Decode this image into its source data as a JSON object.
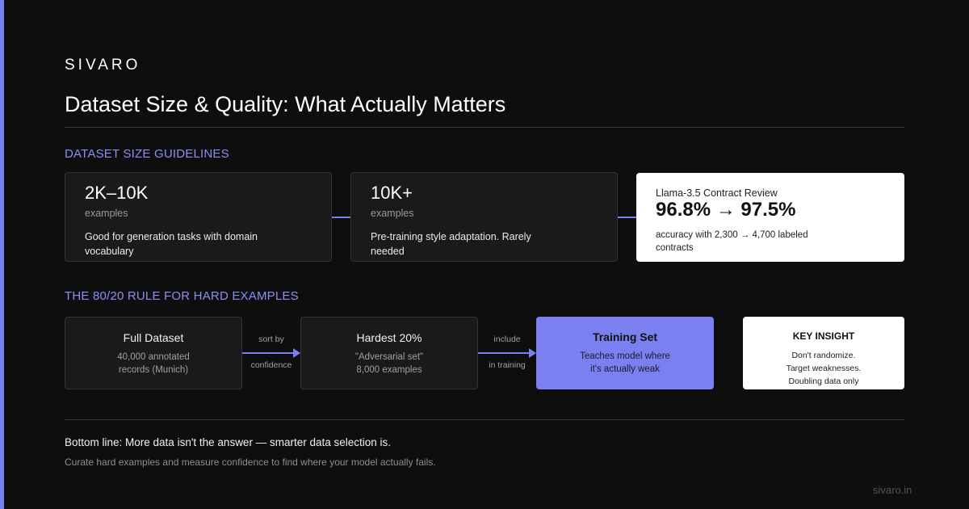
{
  "brand": "SIVARO",
  "title": "Dataset Size & Quality: What Actually Matters",
  "size_section": {
    "label": "DATASET SIZE GUIDELINES",
    "cards": [
      {
        "value": "2K–10K",
        "unit": "examples",
        "description": "Good for generation tasks with domain vocabulary"
      },
      {
        "value": "10K+",
        "unit": "examples",
        "description": "Pre-training style adaptation. Rarely needed"
      }
    ],
    "result": {
      "label": "Llama-3.5 Contract Review",
      "value": "96.8% → 97.5%",
      "sub": "accuracy with 2,300 → 4,700 labeled contracts"
    }
  },
  "flow_section": {
    "label": "THE 80/20 RULE FOR HARD EXAMPLES",
    "steps": [
      {
        "title": "Full Dataset",
        "sub_lines": [
          "40,000 annotated",
          "records (Munich)"
        ]
      },
      {
        "title": "Hardest 20%",
        "sub_lines": [
          "\"Adversarial set\"",
          "8,000 examples"
        ]
      },
      {
        "title": "Training Set",
        "sub_lines": [
          "Teaches model where",
          "it's actually weak"
        ]
      }
    ],
    "arrows": [
      {
        "top": "sort by",
        "bottom": "confidence"
      },
      {
        "top": "include",
        "bottom": "in training"
      }
    ],
    "insight": {
      "title": "KEY INSIGHT",
      "lines": [
        "Don't randomize.",
        "Target weaknesses.",
        "Doubling data only"
      ]
    }
  },
  "bottom": {
    "main": "Bottom line: More data isn't the answer — smarter data selection is.",
    "sub": "Curate hard examples and measure confidence to find where your model actually fails."
  },
  "footer": "sivaro.in",
  "colors": {
    "accent": "#7b80f0",
    "background": "#0e0e0e",
    "card": "#1a1a1a"
  }
}
